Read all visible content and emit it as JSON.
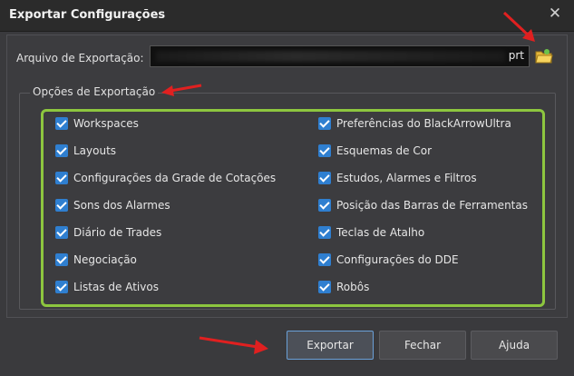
{
  "dialog": {
    "title": "Exportar Configurações"
  },
  "file": {
    "label": "Arquivo de Exportação:",
    "extension": "prt"
  },
  "group": {
    "title": "Opções de Exportação"
  },
  "options_left": [
    {
      "label": "Workspaces",
      "checked": true
    },
    {
      "label": "Layouts",
      "checked": true
    },
    {
      "label": "Configurações da Grade de Cotações",
      "checked": true
    },
    {
      "label": "Sons dos Alarmes",
      "checked": true
    },
    {
      "label": "Diário de Trades",
      "checked": true
    },
    {
      "label": "Negociação",
      "checked": true
    },
    {
      "label": "Listas de Ativos",
      "checked": true
    }
  ],
  "options_right": [
    {
      "label": "Preferências do BlackArrowUltra",
      "checked": true
    },
    {
      "label": "Esquemas de Cor",
      "checked": true
    },
    {
      "label": "Estudos, Alarmes e Filtros",
      "checked": true
    },
    {
      "label": "Posição das Barras de Ferramentas",
      "checked": true
    },
    {
      "label": "Teclas de Atalho",
      "checked": true
    },
    {
      "label": "Configurações do DDE",
      "checked": true
    },
    {
      "label": "Robôs",
      "checked": true
    }
  ],
  "buttons": {
    "export": "Exportar",
    "close": "Fechar",
    "help": "Ajuda"
  },
  "colors": {
    "highlight_border": "#8dc63f",
    "checkbox": "#2f7fd0",
    "arrow": "#e02020"
  }
}
